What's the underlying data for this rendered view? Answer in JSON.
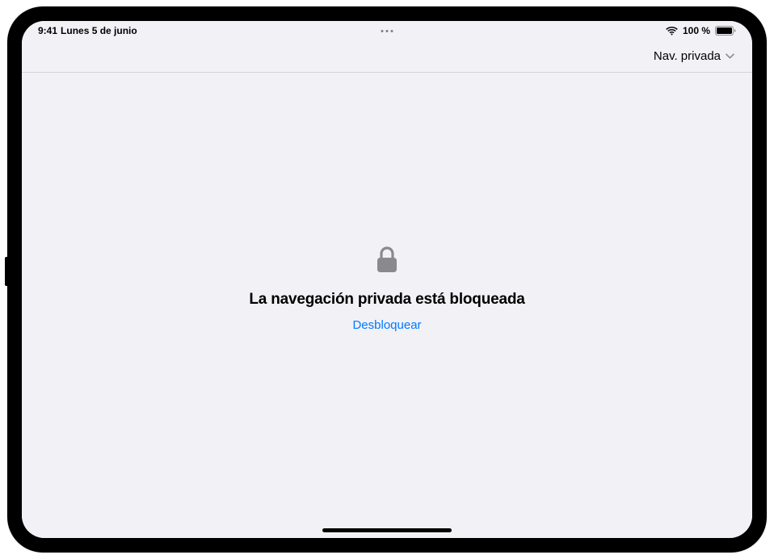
{
  "status_bar": {
    "time": "9:41",
    "date": "Lunes 5 de junio",
    "battery_text": "100 %"
  },
  "toolbar": {
    "tab_group_label": "Nav. privada"
  },
  "content": {
    "locked_title": "La navegación privada está bloqueada",
    "unlock_label": "Desbloquear"
  }
}
